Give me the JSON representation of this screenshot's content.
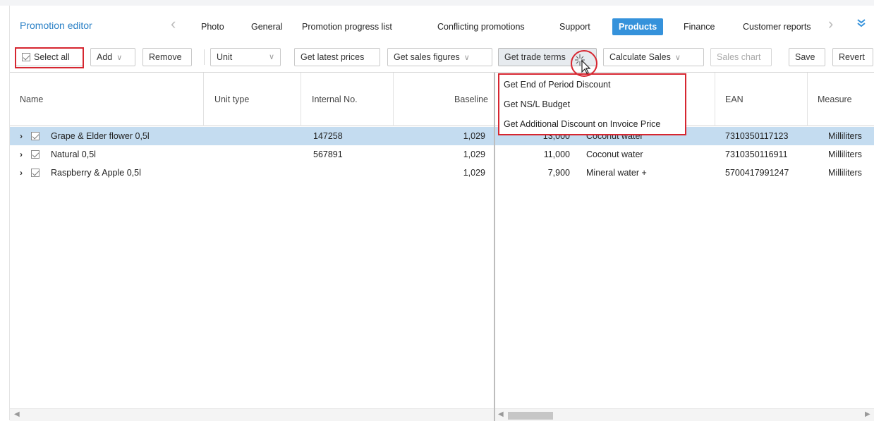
{
  "app_title": "Promotion editor",
  "tabs": [
    "Photo",
    "General",
    "Promotion progress list",
    "Conflicting promotions",
    "Support",
    "Products",
    "Finance",
    "Customer reports"
  ],
  "active_tab": "Products",
  "nav": {
    "prev_icon": "chevron-left-icon",
    "next_icon": "chevron-right-icon",
    "more_icon": "double-chevron-down-icon"
  },
  "toolbar": {
    "select_all": "Select all",
    "add": "Add",
    "remove": "Remove",
    "unit_select": "Unit",
    "get_latest_prices": "Get latest prices",
    "get_sales_figures": "Get sales figures",
    "get_trade_terms": "Get trade terms",
    "calculate_sales": "Calculate Sales",
    "sales_chart": "Sales chart",
    "save": "Save",
    "revert": "Revert"
  },
  "dropdown": {
    "items": [
      "Get End of Period Discount",
      "Get NS/L Budget",
      "Get Additional Discount on Invoice Price"
    ]
  },
  "columns": {
    "name": "Name",
    "unit_type": "Unit type",
    "internal_no": "Internal No.",
    "baseline": "Baseline",
    "ean": "EAN",
    "measure": "Measure"
  },
  "rows": [
    {
      "name": "Grape & Elder flower 0,5l",
      "internal_no": "147258",
      "baseline": "1,029",
      "value": "13,000",
      "category": "Coconut water",
      "ean": "7310350117123",
      "measure": "Milliliters"
    },
    {
      "name": "Natural 0,5l",
      "internal_no": "567891",
      "baseline": "1,029",
      "value": "11,000",
      "category": "Coconut water",
      "ean": "7310350116911",
      "measure": "Milliliters"
    },
    {
      "name": "Raspberry & Apple 0,5l",
      "internal_no": "",
      "baseline": "1,029",
      "value": "7,900",
      "category": "Mineral water +",
      "ean": "5700417991247",
      "measure": "Milliliters"
    }
  ],
  "colors": {
    "accent": "#3592db",
    "selected_row": "#c4dcf0",
    "highlight": "#d62630",
    "title": "#2a80c6"
  }
}
